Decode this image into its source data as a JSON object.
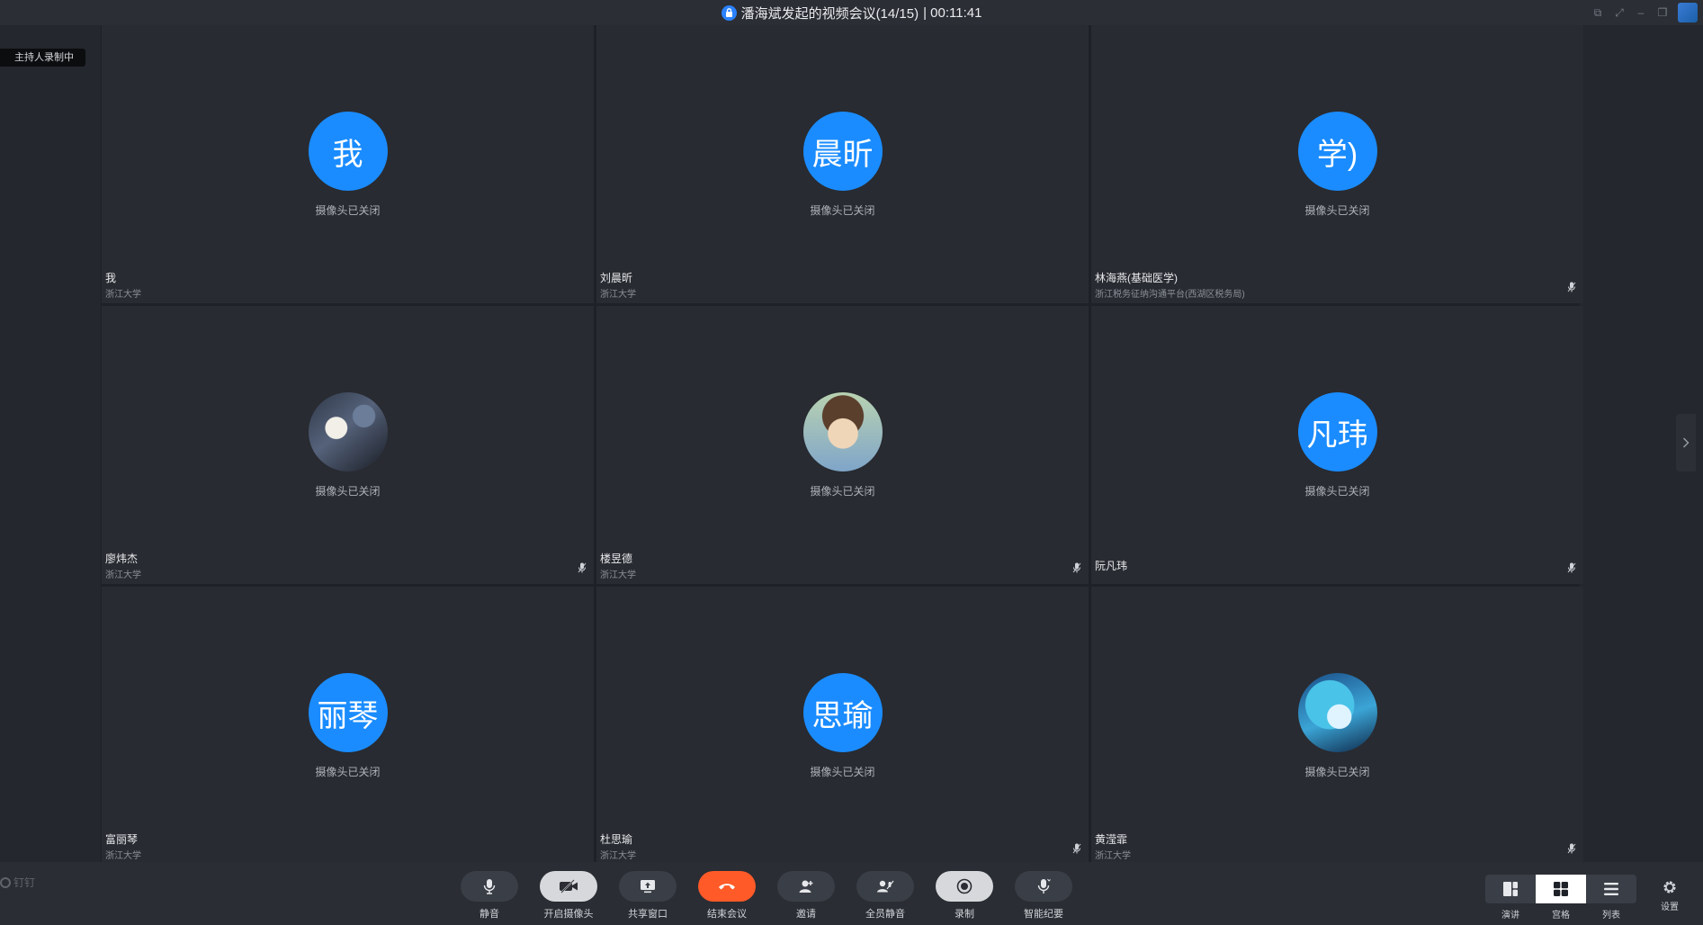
{
  "window": {
    "title": "潘海斌发起的视频会议(14/15)",
    "timer": "| 00:11:41"
  },
  "recording_badge": "主持人录制中",
  "participants": [
    {
      "avatar_text": "我",
      "status": "摄像头已关闭",
      "name": "我",
      "org": "浙江大学",
      "muted": false
    },
    {
      "avatar_text": "晨昕",
      "status": "摄像头已关闭",
      "name": "刘晨昕",
      "org": "浙江大学",
      "muted": false
    },
    {
      "avatar_text": "学)",
      "status": "摄像头已关闭",
      "name": "林海燕(基础医学)",
      "org": "浙江税务征纳沟通平台(西湖区税务局)",
      "muted": true
    },
    {
      "avatar_text": "",
      "status": "摄像头已关闭",
      "name": "廖炜杰",
      "org": "浙江大学",
      "muted": true
    },
    {
      "avatar_text": "",
      "status": "摄像头已关闭",
      "name": "楼昱德",
      "org": "浙江大学",
      "muted": true
    },
    {
      "avatar_text": "凡玮",
      "status": "摄像头已关闭",
      "name": "阮凡玮",
      "org": "",
      "muted": true
    },
    {
      "avatar_text": "丽琴",
      "status": "摄像头已关闭",
      "name": "富丽琴",
      "org": "浙江大学",
      "muted": false
    },
    {
      "avatar_text": "思瑜",
      "status": "摄像头已关闭",
      "name": "杜思瑜",
      "org": "浙江大学",
      "muted": true
    },
    {
      "avatar_text": "",
      "status": "摄像头已关闭",
      "name": "黄滢霏",
      "org": "浙江大学",
      "muted": true
    }
  ],
  "brand": "钉钉",
  "toolbar": {
    "mute": "静音",
    "camera": "开启摄像头",
    "share": "共享窗口",
    "end": "结束会议",
    "invite": "邀请",
    "mute_all": "全员静音",
    "record": "录制",
    "smart_minutes": "智能纪要"
  },
  "views": {
    "presenter": "演讲",
    "grid": "宫格",
    "list": "列表"
  },
  "settings": "设置",
  "colors": {
    "accent": "#1a8cff",
    "end_call": "#ff5a28"
  }
}
